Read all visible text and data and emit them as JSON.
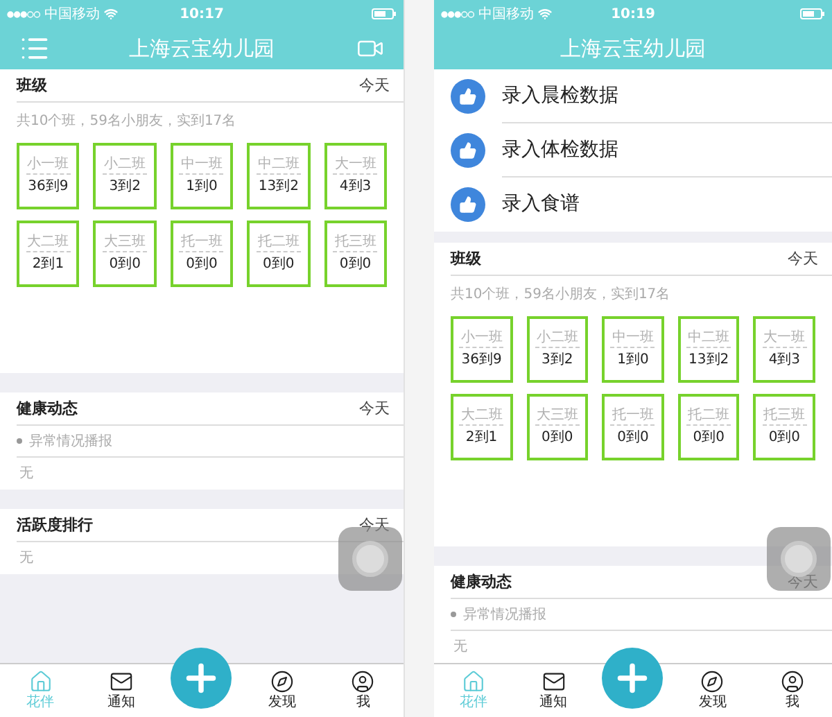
{
  "phones": [
    {
      "status_bar": {
        "carrier": "中国移动",
        "time": "10:17"
      },
      "header": {
        "title": "上海云宝幼儿园",
        "menu_button": true,
        "video_button": true
      },
      "sections": [
        {
          "kind": "classes",
          "title": "班级",
          "date": "今天",
          "summary": "共10个班，59名小朋友，实到17名",
          "classes": [
            {
              "name": "小一班",
              "count": "36到9"
            },
            {
              "name": "小二班",
              "count": "3到2"
            },
            {
              "name": "中一班",
              "count": "1到0"
            },
            {
              "name": "中二班",
              "count": "13到2"
            },
            {
              "name": "大一班",
              "count": "4到3"
            },
            {
              "name": "大二班",
              "count": "2到1"
            },
            {
              "name": "大三班",
              "count": "0到0"
            },
            {
              "name": "托一班",
              "count": "0到0"
            },
            {
              "name": "托二班",
              "count": "0到0"
            },
            {
              "name": "托三班",
              "count": "0到0"
            }
          ]
        },
        {
          "kind": "feed",
          "title": "健康动态",
          "date": "今天",
          "rows": [
            {
              "text": "异常情况播报",
              "bullet": true
            },
            {
              "text": "无",
              "bullet": false
            }
          ]
        },
        {
          "kind": "feed",
          "title": "活跃度排行",
          "date": "今天",
          "rows": [
            {
              "text": "无",
              "bullet": false
            }
          ]
        }
      ],
      "tab_bar": [
        {
          "kind": "tab",
          "label": "花伴",
          "selected": true
        },
        {
          "kind": "tab",
          "label": "通知",
          "selected": false
        },
        {
          "kind": "add"
        },
        {
          "kind": "tab",
          "label": "发现",
          "selected": false
        },
        {
          "kind": "tab",
          "label": "我",
          "selected": false
        }
      ]
    },
    {
      "status_bar": {
        "carrier": "中国移动",
        "time": "10:19"
      },
      "header": {
        "title": "上海云宝幼儿园",
        "menu_button": false,
        "video_button": false
      },
      "sections": [
        {
          "kind": "actions",
          "items": [
            {
              "label": "录入晨检数据"
            },
            {
              "label": "录入体检数据"
            },
            {
              "label": "录入食谱"
            }
          ]
        },
        {
          "kind": "classes",
          "title": "班级",
          "date": "今天",
          "summary": "共10个班，59名小朋友，实到17名",
          "classes": [
            {
              "name": "小一班",
              "count": "36到9"
            },
            {
              "name": "小二班",
              "count": "3到2"
            },
            {
              "name": "中一班",
              "count": "1到0"
            },
            {
              "name": "中二班",
              "count": "13到2"
            },
            {
              "name": "大一班",
              "count": "4到3"
            },
            {
              "name": "大二班",
              "count": "2到1"
            },
            {
              "name": "大三班",
              "count": "0到0"
            },
            {
              "name": "托一班",
              "count": "0到0"
            },
            {
              "name": "托二班",
              "count": "0到0"
            },
            {
              "name": "托三班",
              "count": "0到0"
            }
          ]
        },
        {
          "kind": "feed",
          "title": "健康动态",
          "date": "今天",
          "rows": [
            {
              "text": "异常情况播报",
              "bullet": true
            },
            {
              "text": "无",
              "bullet": false
            }
          ]
        }
      ],
      "tab_bar": [
        {
          "kind": "tab",
          "label": "花伴",
          "selected": true
        },
        {
          "kind": "tab",
          "label": "通知",
          "selected": false
        },
        {
          "kind": "add"
        },
        {
          "kind": "tab",
          "label": "发现",
          "selected": false
        },
        {
          "kind": "tab",
          "label": "我",
          "selected": false
        }
      ]
    }
  ]
}
